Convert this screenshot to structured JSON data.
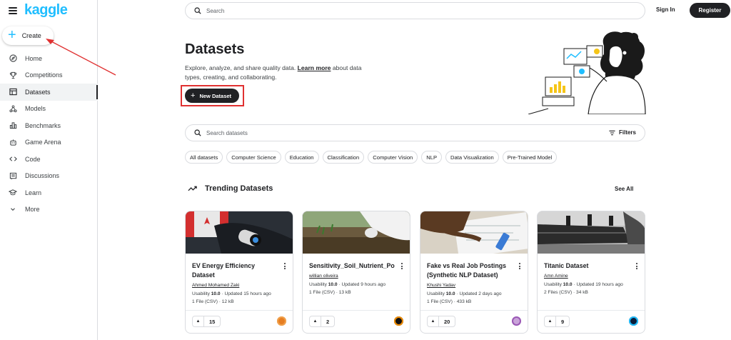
{
  "app": {
    "logo": "kaggle"
  },
  "sidebar": {
    "create_label": "Create",
    "items": [
      {
        "label": "Home",
        "icon": "compass-icon"
      },
      {
        "label": "Competitions",
        "icon": "trophy-icon"
      },
      {
        "label": "Datasets",
        "icon": "table-icon",
        "active": true
      },
      {
        "label": "Models",
        "icon": "models-icon"
      },
      {
        "label": "Benchmarks",
        "icon": "bar-chart-icon"
      },
      {
        "label": "Game Arena",
        "icon": "robot-icon"
      },
      {
        "label": "Code",
        "icon": "code-icon"
      },
      {
        "label": "Discussions",
        "icon": "discussion-icon"
      },
      {
        "label": "Learn",
        "icon": "graduation-cap-icon"
      },
      {
        "label": "More",
        "icon": "chevron-down-icon"
      }
    ]
  },
  "header": {
    "search_placeholder": "Search",
    "signin_label": "Sign In",
    "register_label": "Register"
  },
  "main": {
    "title": "Datasets",
    "desc_before": "Explore, analyze, and share quality data. ",
    "learn_more": "Learn more",
    "desc_after": " about data types, creating, and collaborating.",
    "new_dataset_label": "New Dataset",
    "search_datasets_placeholder": "Search datasets",
    "filters_label": "Filters",
    "chips": [
      "All datasets",
      "Computer Science",
      "Education",
      "Classification",
      "Computer Vision",
      "NLP",
      "Data Visualization",
      "Pre-Trained Model"
    ],
    "trending_title": "Trending Datasets",
    "see_all_label": "See All"
  },
  "cards": [
    {
      "title": "EV Energy Efficiency Dataset",
      "author": "Ahmed Mohamed Zaki",
      "usability_label": "Usability",
      "usability": "10.0",
      "updated": "Updated 15 hours ago",
      "files": "1 File (CSV) · 12 kB",
      "votes": "15"
    },
    {
      "title": "Sensitivity_Soil_Nutrient_Po(",
      "author": "willian oliveira",
      "usability_label": "Usability",
      "usability": "10.0",
      "updated": "Updated 9 hours ago",
      "files": "1 File (CSV) · 13 kB",
      "votes": "2"
    },
    {
      "title": "Fake vs Real Job Postings (Synthetic NLP Dataset)",
      "author": "Khushi Yadav",
      "usability_label": "Usability",
      "usability": "10.0",
      "updated": "Updated 2 days ago",
      "files": "1 File (CSV) · 433 kB",
      "votes": "20"
    },
    {
      "title": "Titanic Dataset",
      "author": "Amn Amine",
      "usability_label": "Usability",
      "usability": "10.0",
      "updated": "Updated 19 hours ago",
      "files": "2 Files (CSV) · 34 kB",
      "votes": "9"
    }
  ],
  "colors": {
    "brand": "#20beff",
    "dark": "#202124",
    "annotation": "#e03131"
  }
}
